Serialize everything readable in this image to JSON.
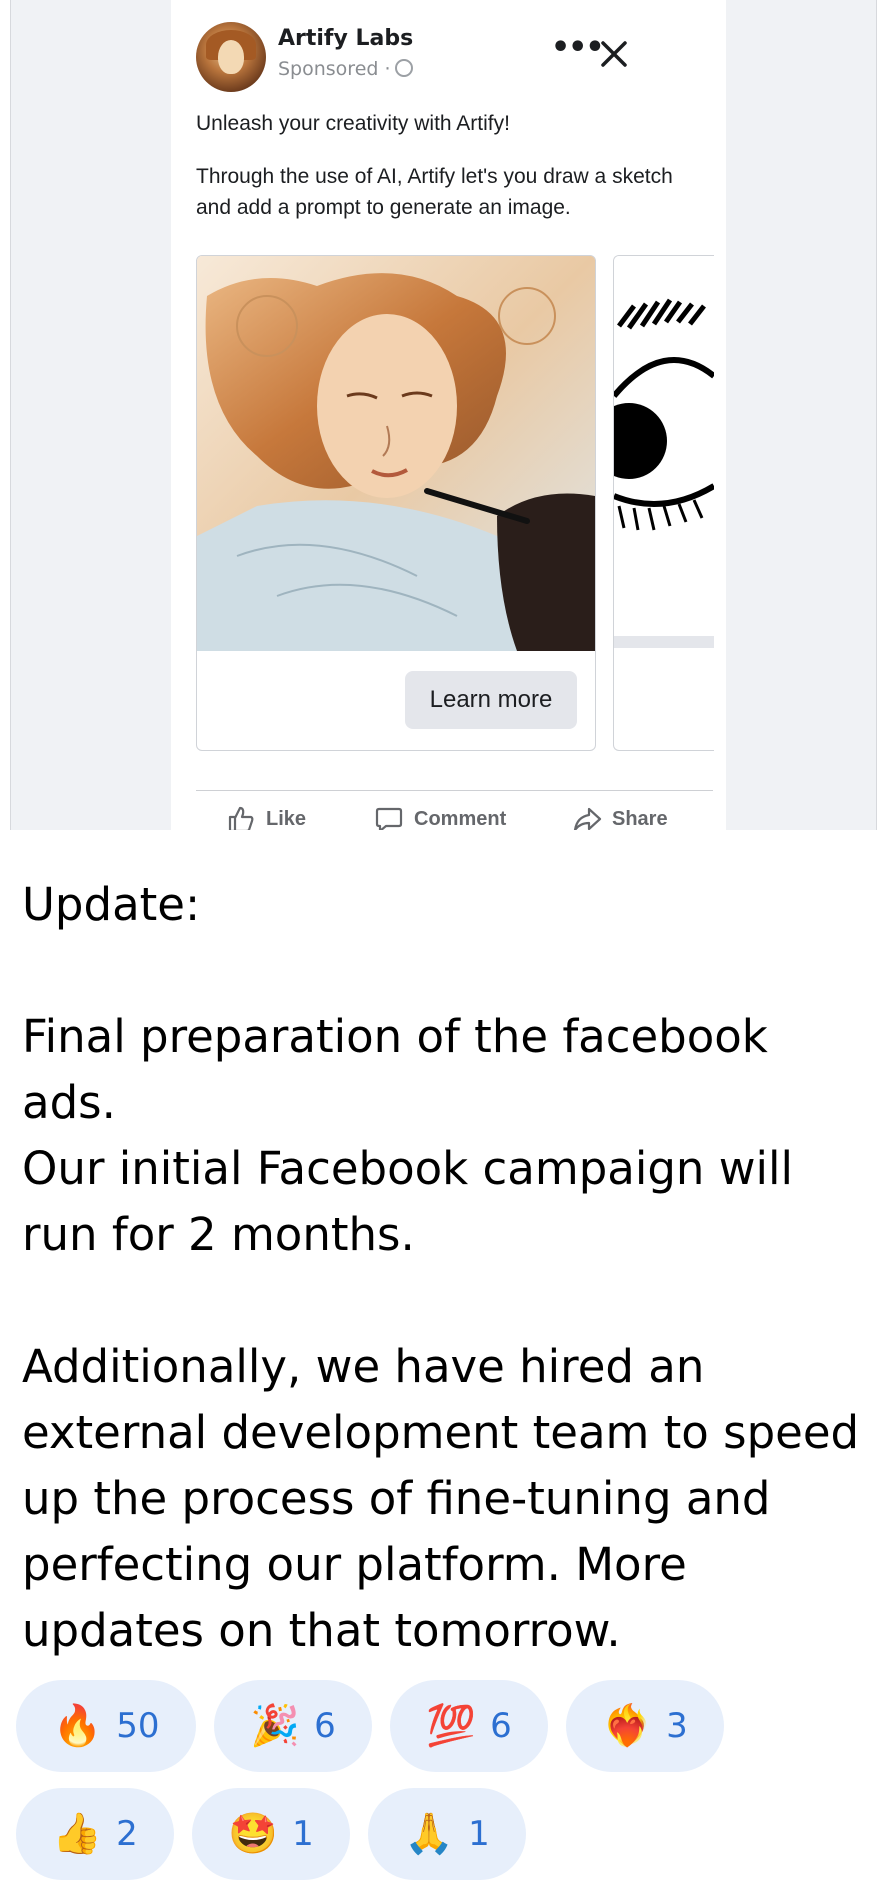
{
  "ad": {
    "page_name": "Artify Labs",
    "sponsored_label": "Sponsored ·",
    "headline": "Unleash your creativity with Artify!",
    "body": "Through the use of AI, Artify let's you draw a sketch and add a prompt to generate an image.",
    "cta_label": "Learn more",
    "actions": {
      "like": "Like",
      "comment": "Comment",
      "share": "Share"
    },
    "icons": {
      "more": "more-icon",
      "close": "close-icon",
      "like": "thumbs-up-icon",
      "comment": "comment-icon",
      "share": "share-icon"
    }
  },
  "message": {
    "text": "Update:\n\nFinal preparation of the facebook ads.\nOur initial Facebook campaign will run for 2 months.\n\nAdditionally, we have hired an external development team to speed up the process of fine-tuning and perfecting our platform. More updates on that tomorrow."
  },
  "reactions": [
    {
      "emoji": "🔥",
      "name": "fire",
      "count": "50"
    },
    {
      "emoji": "🎉",
      "name": "party-popper",
      "count": "6"
    },
    {
      "emoji": "💯",
      "name": "hundred-points",
      "count": "6"
    },
    {
      "emoji": "❤️‍🔥",
      "name": "heart-on-fire",
      "count": "3"
    },
    {
      "emoji": "👍",
      "name": "thumbs-up",
      "count": "2"
    },
    {
      "emoji": "🤩",
      "name": "star-struck",
      "count": "1"
    },
    {
      "emoji": "🙏",
      "name": "folded-hands",
      "count": "1"
    }
  ],
  "colors": {
    "reaction_bg": "#e7effb",
    "reaction_count": "#2c6fd1",
    "facebook_gray": "#65676b"
  }
}
